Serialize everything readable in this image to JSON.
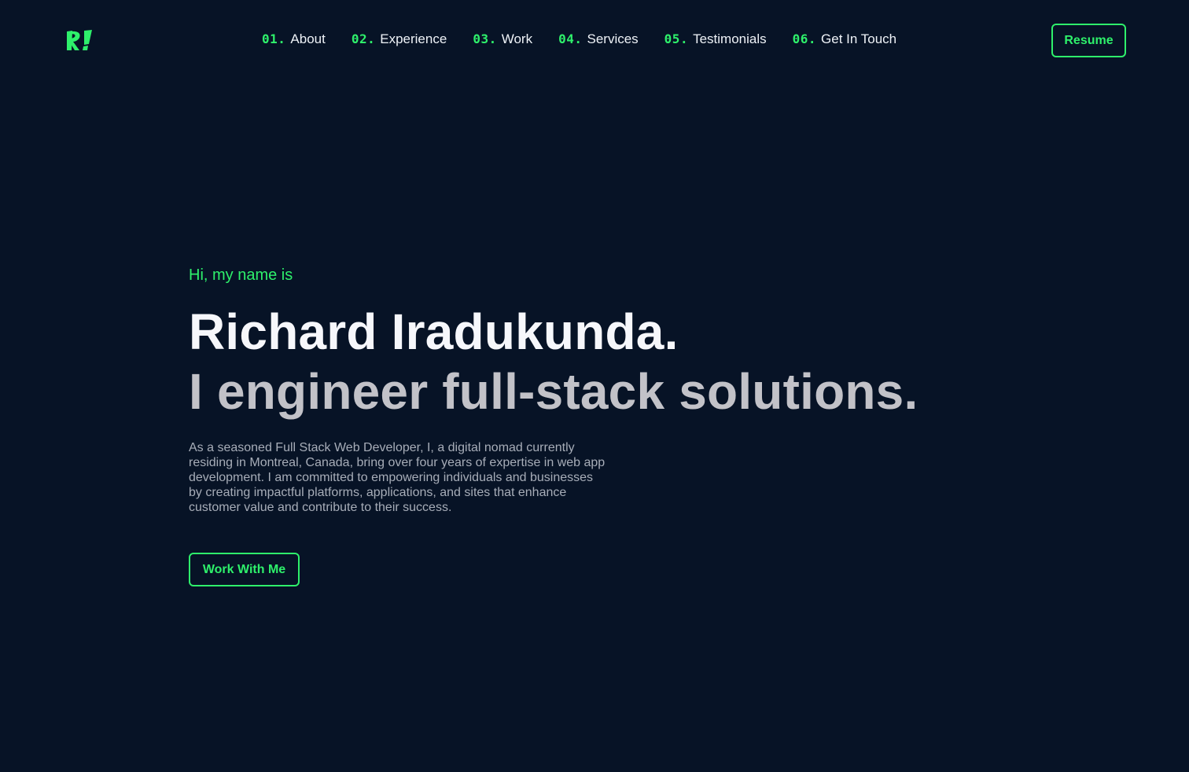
{
  "brand": {
    "logo_text": "RI",
    "accent_color": "#2ef06b",
    "background_color": "#071326"
  },
  "nav": {
    "items": [
      {
        "number": "01.",
        "label": "About"
      },
      {
        "number": "02.",
        "label": "Experience"
      },
      {
        "number": "03.",
        "label": "Work"
      },
      {
        "number": "04.",
        "label": "Services"
      },
      {
        "number": "05.",
        "label": "Testimonials"
      },
      {
        "number": "06.",
        "label": "Get In Touch"
      }
    ],
    "resume_label": "Resume"
  },
  "hero": {
    "intro": "Hi, my name is",
    "name": "Richard Iradukunda.",
    "tagline": "I engineer full-stack solutions.",
    "description": "As a seasoned Full Stack Web Developer, I, a digital nomad currently residing in Montreal, Canada, bring over four years of expertise in web app development. I am committed to empowering individuals and businesses  by creating impactful platforms, applications, and sites that enhance customer value and contribute to their success.",
    "cta_label": "Work With Me"
  }
}
